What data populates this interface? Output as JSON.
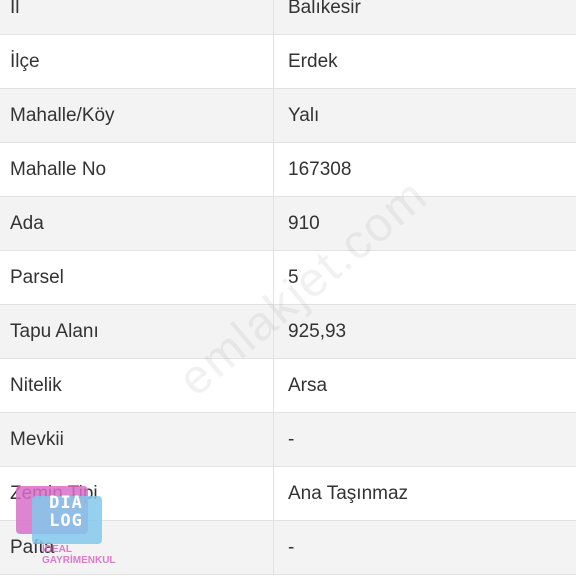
{
  "rows": [
    {
      "key": "İl",
      "value": "Balıkesir"
    },
    {
      "key": "İlçe",
      "value": "Erdek"
    },
    {
      "key": "Mahalle/Köy",
      "value": "Yalı"
    },
    {
      "key": "Mahalle No",
      "value": "167308"
    },
    {
      "key": "Ada",
      "value": "910"
    },
    {
      "key": "Parsel",
      "value": "5"
    },
    {
      "key": "Tapu Alanı",
      "value": "925,93"
    },
    {
      "key": "Nitelik",
      "value": "Arsa"
    },
    {
      "key": "Mevkii",
      "value": "-"
    },
    {
      "key": "Zemin Tipi",
      "value": "Ana Taşınmaz"
    },
    {
      "key": "Pafta",
      "value": "-"
    }
  ],
  "watermark": "emlakjet.com",
  "logo": {
    "line1": "DIA",
    "line2": "LOG",
    "sub1": "İDEAL",
    "sub2": "GAYRİMENKUL"
  }
}
